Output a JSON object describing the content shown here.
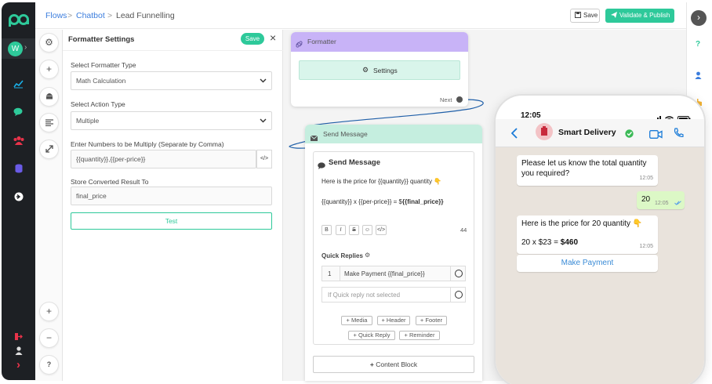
{
  "breadcrumb": {
    "flows": "Flows",
    "sep1": ">",
    "chatbot": "Chatbot",
    "sep2": ">",
    "current": "Lead Funnelling"
  },
  "topbar": {
    "save_label": "Save",
    "publish_label": "Validate & Publish"
  },
  "rail": {
    "avatar_initial": "W"
  },
  "panel": {
    "title": "Formatter Settings",
    "save_label": "Save",
    "close_glyph": "×",
    "formatter_type_label": "Select Formatter Type",
    "formatter_type_value": "Math Calculation",
    "action_type_label": "Select Action Type",
    "action_type_value": "Multiple",
    "numbers_label": "Enter Numbers to be Multiply (Separate by Comma)",
    "numbers_value": "{{quantity}},{{per-price}}",
    "code_glyph": "</>",
    "result_label": "Store Converted Result To",
    "result_value": "final_price",
    "test_label": "Test"
  },
  "formatter_node": {
    "header": "Formatter",
    "settings_label": "Settings",
    "next_label": "Next"
  },
  "message_node": {
    "header": "Send Message",
    "title": "Send Message",
    "line1": "Here is the price for {{quantity}} quantity 👇",
    "line2": "{{quantity}} x {{per-price}} = $",
    "line2_bold": "{{final_price}}",
    "format_buttons": [
      "B",
      "I",
      "S",
      "☺",
      "</>"
    ],
    "char_count": "44",
    "quick_replies_label": "Quick Replies",
    "reply1_index": "1",
    "reply1_text": "Make Payment {{final_price}}",
    "reply2_placeholder": "If Quick reply not selected",
    "add_buttons_row1": [
      "+ Media",
      "+ Header",
      "+ Footer"
    ],
    "add_buttons_row2": [
      "+ Quick Reply",
      "+ Reminder"
    ],
    "content_block_label": "Content Block",
    "content_block_plus": "+"
  },
  "phone": {
    "time": "12:05",
    "contact_name": "Smart Delivery",
    "messages": [
      {
        "text1": "Please let us know the total quantity",
        "text2": "you required?",
        "time": "12:05"
      },
      {
        "text": "20",
        "time": "12:05"
      },
      {
        "text1": "Here is the price for 20 quantity 👇",
        "text2": "20 x $23 = ",
        "text2_bold": "$460",
        "time": "12:05"
      }
    ],
    "button_label": "Make Payment"
  },
  "colors": {
    "accent": "#2ec99a",
    "rail_bg": "#1d2024",
    "formatter_header": "#c8b3f7",
    "message_header": "#c5eedf",
    "chat_bg": "#e9e3dc",
    "incoming": "#ffffff",
    "outgoing": "#dcf8c6",
    "brand_red": "#e8334a"
  }
}
